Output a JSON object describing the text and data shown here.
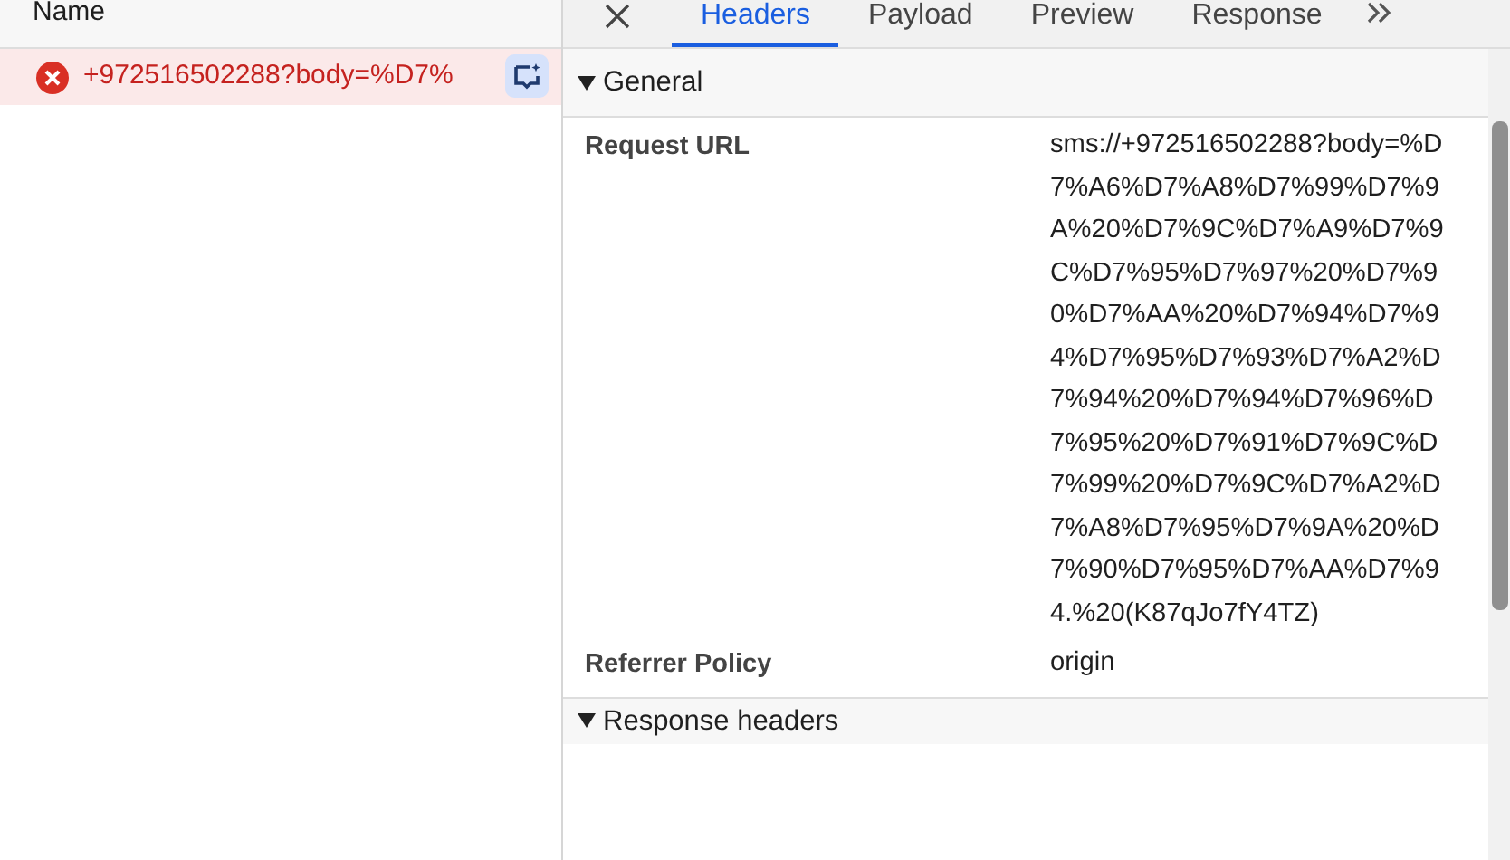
{
  "requests": {
    "column_header": "Name",
    "rows": [
      {
        "name": "+972516502288?body=%D7%",
        "failed": true,
        "selected": true
      }
    ]
  },
  "tabs": [
    {
      "label": "Headers",
      "selected": true
    },
    {
      "label": "Payload",
      "selected": false
    },
    {
      "label": "Preview",
      "selected": false
    },
    {
      "label": "Response",
      "selected": false
    }
  ],
  "sections": [
    {
      "title": "General",
      "expanded": true,
      "rows": [
        {
          "name": "Request URL",
          "value": "sms://+972516502288?body=%D7%A6%D7%A8%D7%99%D7%9A%20%D7%9C%D7%A9%D7%9C%D7%95%D7%97%20%D7%90%D7%AA%20%D7%94%D7%94%D7%95%D7%93%D7%A2%D7%94%20%D7%94%D7%96%D7%95%20%D7%91%D7%9C%D7%99%20%D7%9C%D7%A2%D7%A8%D7%95%D7%9A%20%D7%90%D7%95%D7%AA%D7%94.%20(K87qJo7fY4TZ)"
        },
        {
          "name": "Referrer Policy",
          "value": "origin"
        }
      ]
    },
    {
      "title": "Response headers",
      "expanded": true
    }
  ]
}
